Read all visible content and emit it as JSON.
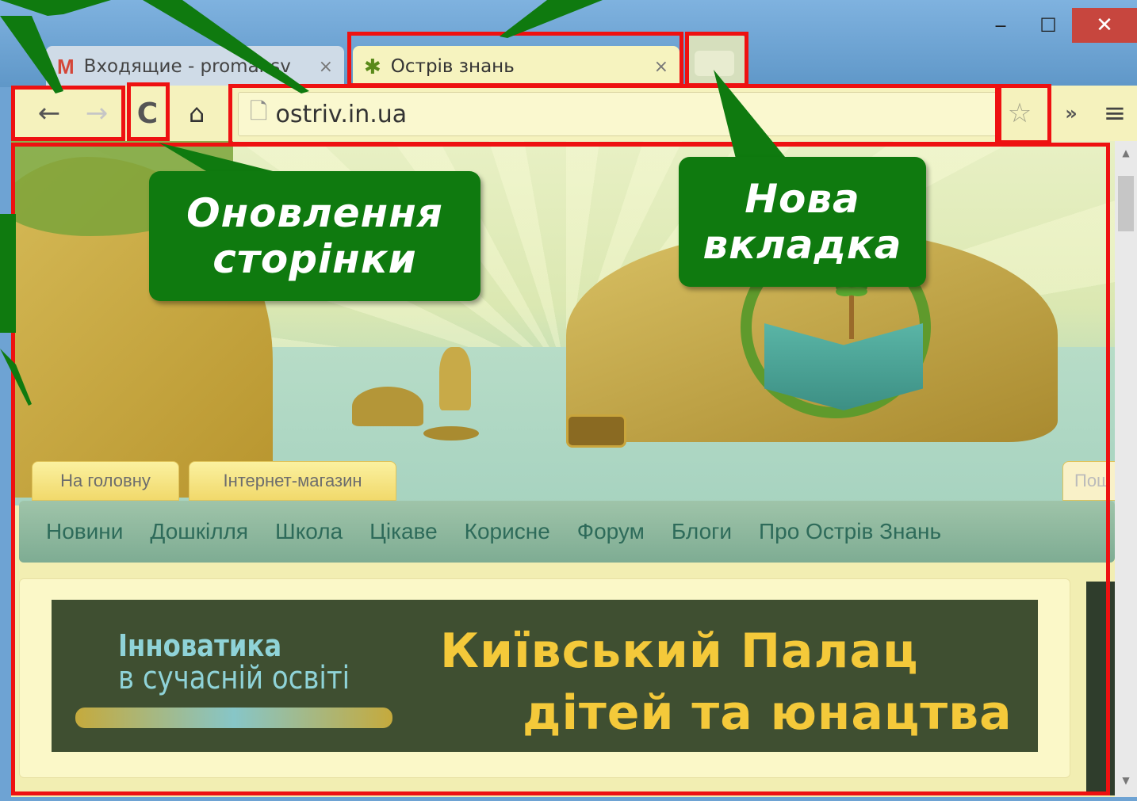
{
  "browser": {
    "window_controls": {
      "minimize": "‒",
      "maximize": "☐",
      "close": "✕"
    },
    "tabs": [
      {
        "title": "Входящие - promansv",
        "icon": "gmail-icon",
        "close": "×"
      },
      {
        "title": "Острів знань",
        "icon": "palm-icon",
        "close": "×"
      }
    ],
    "toolbar": {
      "back": "←",
      "forward": "→",
      "reload": "C",
      "home": "⌂",
      "url": "ostriv.in.ua",
      "star": "☆",
      "extensions": "»",
      "menu": "≡"
    }
  },
  "site": {
    "top_tabs": [
      "На головну",
      "Інтернет-магазин",
      "Пош"
    ],
    "nav": [
      "Новини",
      "Дошкілля",
      "Школа",
      "Цікаве",
      "Корисне",
      "Форум",
      "Блоги",
      "Про Острів Знань"
    ],
    "banner": {
      "left_line_1": "Інноватика",
      "left_line_2": "в сучасній освіті",
      "right_line_1": "Київський Палац",
      "right_line_2": "дітей та юнацтва"
    }
  },
  "annotations": {
    "reload_callout": [
      "Оновлення",
      "сторінки"
    ],
    "new_tab_callout": [
      "Нова",
      "вкладка"
    ]
  },
  "colors": {
    "highlight": "#ee1111",
    "callout": "#0f7a0f",
    "toolbar": "#f5f2bd"
  }
}
